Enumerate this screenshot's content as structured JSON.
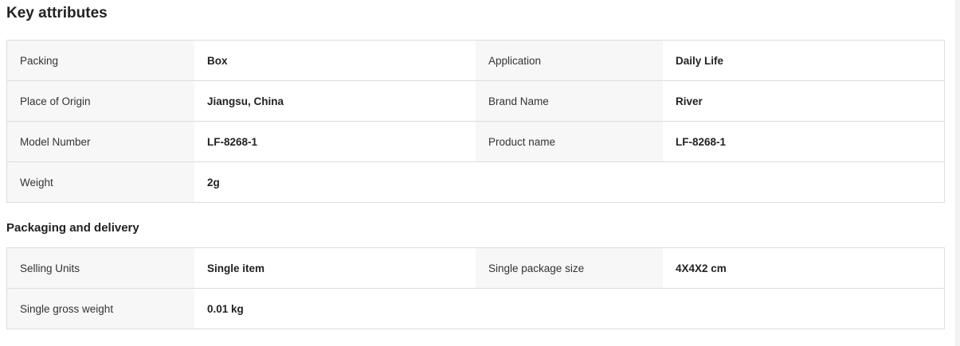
{
  "key_attributes": {
    "title": "Key attributes",
    "rows": [
      {
        "label1": "Packing",
        "value1": "Box",
        "label2": "Application",
        "value2": "Daily Life"
      },
      {
        "label1": "Place of Origin",
        "value1": "Jiangsu, China",
        "label2": "Brand Name",
        "value2": "River"
      },
      {
        "label1": "Model Number",
        "value1": "LF-8268-1",
        "label2": "Product name",
        "value2": "LF-8268-1"
      },
      {
        "label1": "Weight",
        "value1": "2g"
      }
    ]
  },
  "packaging_delivery": {
    "title": "Packaging and delivery",
    "rows": [
      {
        "label1": "Selling Units",
        "value1": "Single item",
        "label2": "Single package size",
        "value2": "4X4X2 cm"
      },
      {
        "label1": "Single gross weight",
        "value1": "0.01 kg"
      }
    ]
  }
}
